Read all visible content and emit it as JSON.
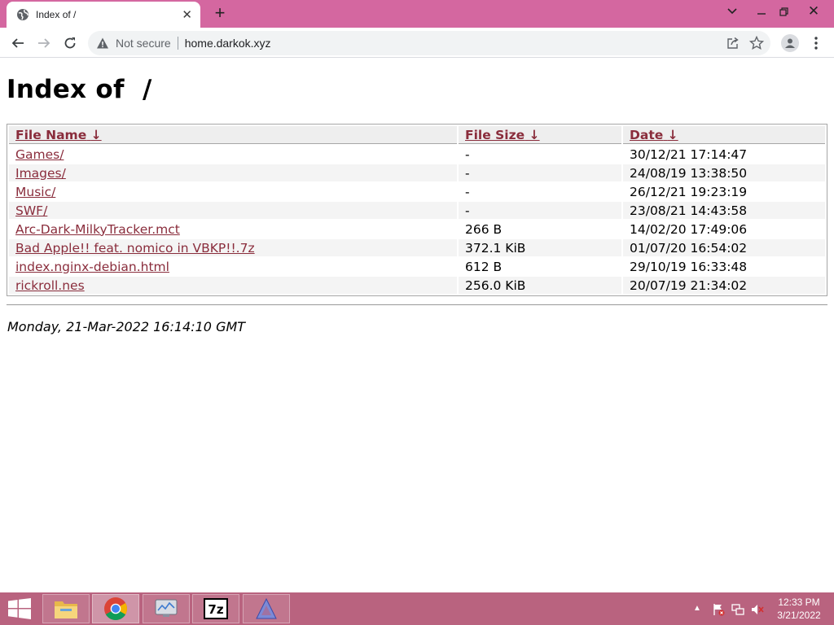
{
  "browser": {
    "tab_title": "Index of /",
    "new_tab_label": "+",
    "address_bar": {
      "security_label": "Not secure",
      "url": "home.darkok.xyz"
    }
  },
  "page": {
    "heading": "Index of  /",
    "columns": [
      {
        "label": "File Name",
        "sort_indicator": "↓"
      },
      {
        "label": "File Size",
        "sort_indicator": "↓"
      },
      {
        "label": "Date",
        "sort_indicator": "↓"
      }
    ],
    "rows": [
      {
        "name": "Games/",
        "size": "-",
        "date": "30/12/21 17:14:47"
      },
      {
        "name": "Images/",
        "size": "-",
        "date": "24/08/19 13:38:50"
      },
      {
        "name": "Music/",
        "size": "-",
        "date": "26/12/21 19:23:19"
      },
      {
        "name": "SWF/",
        "size": "-",
        "date": "23/08/21 14:43:58"
      },
      {
        "name": "Arc-Dark-MilkyTracker.mct",
        "size": "266 B",
        "date": "14/02/20 17:49:06"
      },
      {
        "name": "Bad Apple!! feat. nomico in VBKP!!.7z",
        "size": "372.1 KiB",
        "date": "01/07/20 16:54:02"
      },
      {
        "name": "index.nginx-debian.html",
        "size": "612 B",
        "date": "29/10/19 16:33:48"
      },
      {
        "name": "rickroll.nes",
        "size": "256.0 KiB",
        "date": "20/07/19 21:34:02"
      }
    ],
    "footer_date": "Monday, 21-Mar-2022 16:14:10 GMT"
  },
  "taskbar": {
    "apps": [
      "file-explorer-icon",
      "chrome-icon",
      "performance-monitor-icon",
      "7zip-icon",
      "arch-icon"
    ],
    "clock": {
      "time": "12:33 PM",
      "date": "3/21/2022"
    }
  },
  "colors": {
    "tab_strip": "#d467a0",
    "link": "#8a2d3c",
    "taskbar": "#b9637f"
  }
}
